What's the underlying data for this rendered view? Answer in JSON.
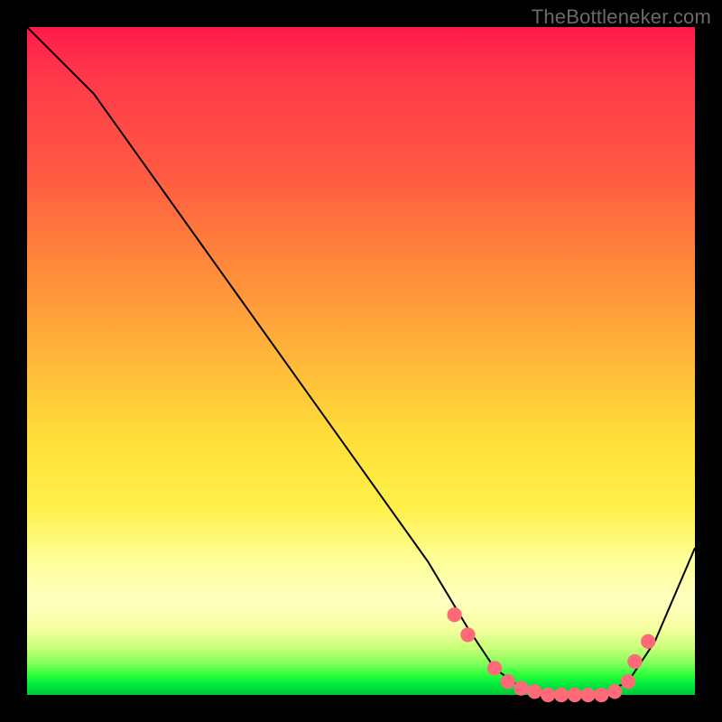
{
  "watermark": "TheBottleneker.com",
  "chart_data": {
    "type": "line",
    "title": "",
    "xlabel": "",
    "ylabel": "",
    "xlim": [
      0,
      100
    ],
    "ylim": [
      0,
      100
    ],
    "series": [
      {
        "name": "curve",
        "x": [
          0,
          4,
          10,
          20,
          30,
          40,
          50,
          60,
          66,
          70,
          74,
          78,
          82,
          86,
          90,
          94,
          100
        ],
        "values": [
          100,
          96,
          90,
          76,
          62,
          48,
          34,
          20,
          10,
          4,
          1,
          0,
          0,
          0,
          2,
          8,
          22
        ]
      }
    ],
    "markers": {
      "comment": "pink dots along the valley of the curve",
      "x": [
        64,
        66,
        70,
        72,
        74,
        76,
        78,
        80,
        82,
        84,
        86,
        88,
        90,
        91,
        93
      ],
      "values": [
        12,
        9,
        4,
        2,
        1,
        0.5,
        0,
        0,
        0,
        0,
        0,
        0.5,
        2,
        5,
        8
      ],
      "color": "#ff6a78",
      "radius": 1.1
    }
  }
}
